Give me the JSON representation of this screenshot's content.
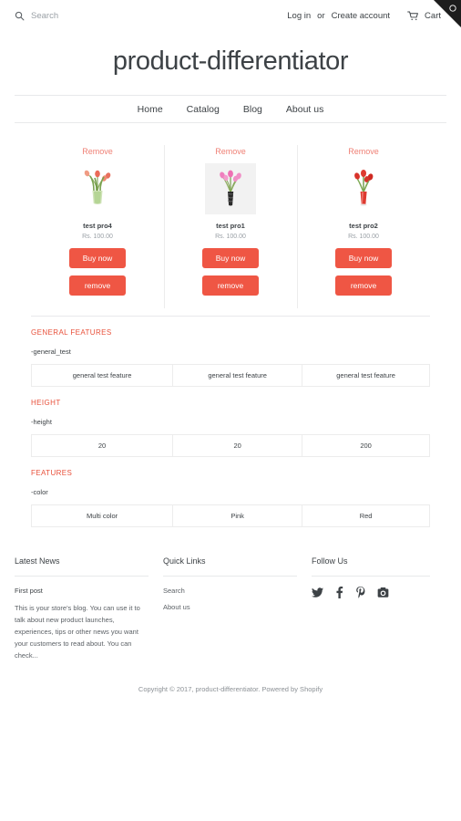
{
  "topbar": {
    "search_placeholder": "Search",
    "search_value": "",
    "search_icon": "search-icon",
    "login_label": "Log in",
    "or_label": "or",
    "create_account_label": "Create account",
    "cart_label": "Cart",
    "cart_icon": "cart-icon",
    "corner_gear_icon": "gear-icon"
  },
  "header": {
    "brand": "product-differentiator",
    "nav": [
      {
        "label": "Home"
      },
      {
        "label": "Catalog"
      },
      {
        "label": "Blog"
      },
      {
        "label": "About us"
      }
    ]
  },
  "compare": {
    "remove_link_label": "Remove",
    "buy_label": "Buy now",
    "remove_button_label": "remove",
    "products": [
      {
        "title": "test pro4",
        "price": "Rs. 100.00",
        "image": "tulips-green-vase"
      },
      {
        "title": "test pro1",
        "price": "Rs. 100.00",
        "image": "pink-tulips-dark-vase"
      },
      {
        "title": "test pro2",
        "price": "Rs. 100.00",
        "image": "red-tulips-red-vase"
      }
    ]
  },
  "specs": [
    {
      "heading": "GENERAL FEATURES",
      "key": "-general_test",
      "values": [
        "general test feature",
        "general test feature",
        "general test feature"
      ]
    },
    {
      "heading": "HEIGHT",
      "key": "-height",
      "values": [
        "20",
        "20",
        "200"
      ]
    },
    {
      "heading": "FEATURES",
      "key": "-color",
      "values": [
        "Multi color",
        "Pink",
        "Red"
      ]
    }
  ],
  "footer": {
    "news": {
      "heading": "Latest News",
      "post_title": "First post",
      "post_body": "This is your store's blog. You can use it to talk about new product launches, experiences, tips or other news you want your customers to read about. You can check..."
    },
    "quick_links": {
      "heading": "Quick Links",
      "items": [
        {
          "label": "Search"
        },
        {
          "label": "About us"
        }
      ]
    },
    "social": {
      "heading": "Follow Us",
      "icons": [
        "twitter-icon",
        "facebook-icon",
        "pinterest-icon",
        "instagram-icon"
      ]
    },
    "copyright": "Copyright © 2017, product-differentiator. Powered by Shopify"
  },
  "colors": {
    "accent": "#ef5644",
    "heading_accent": "#e8503a",
    "remove_link": "#ef7f74",
    "text": "#3d4246",
    "muted": "#9aa0a6",
    "border": "#e8e9eb"
  }
}
